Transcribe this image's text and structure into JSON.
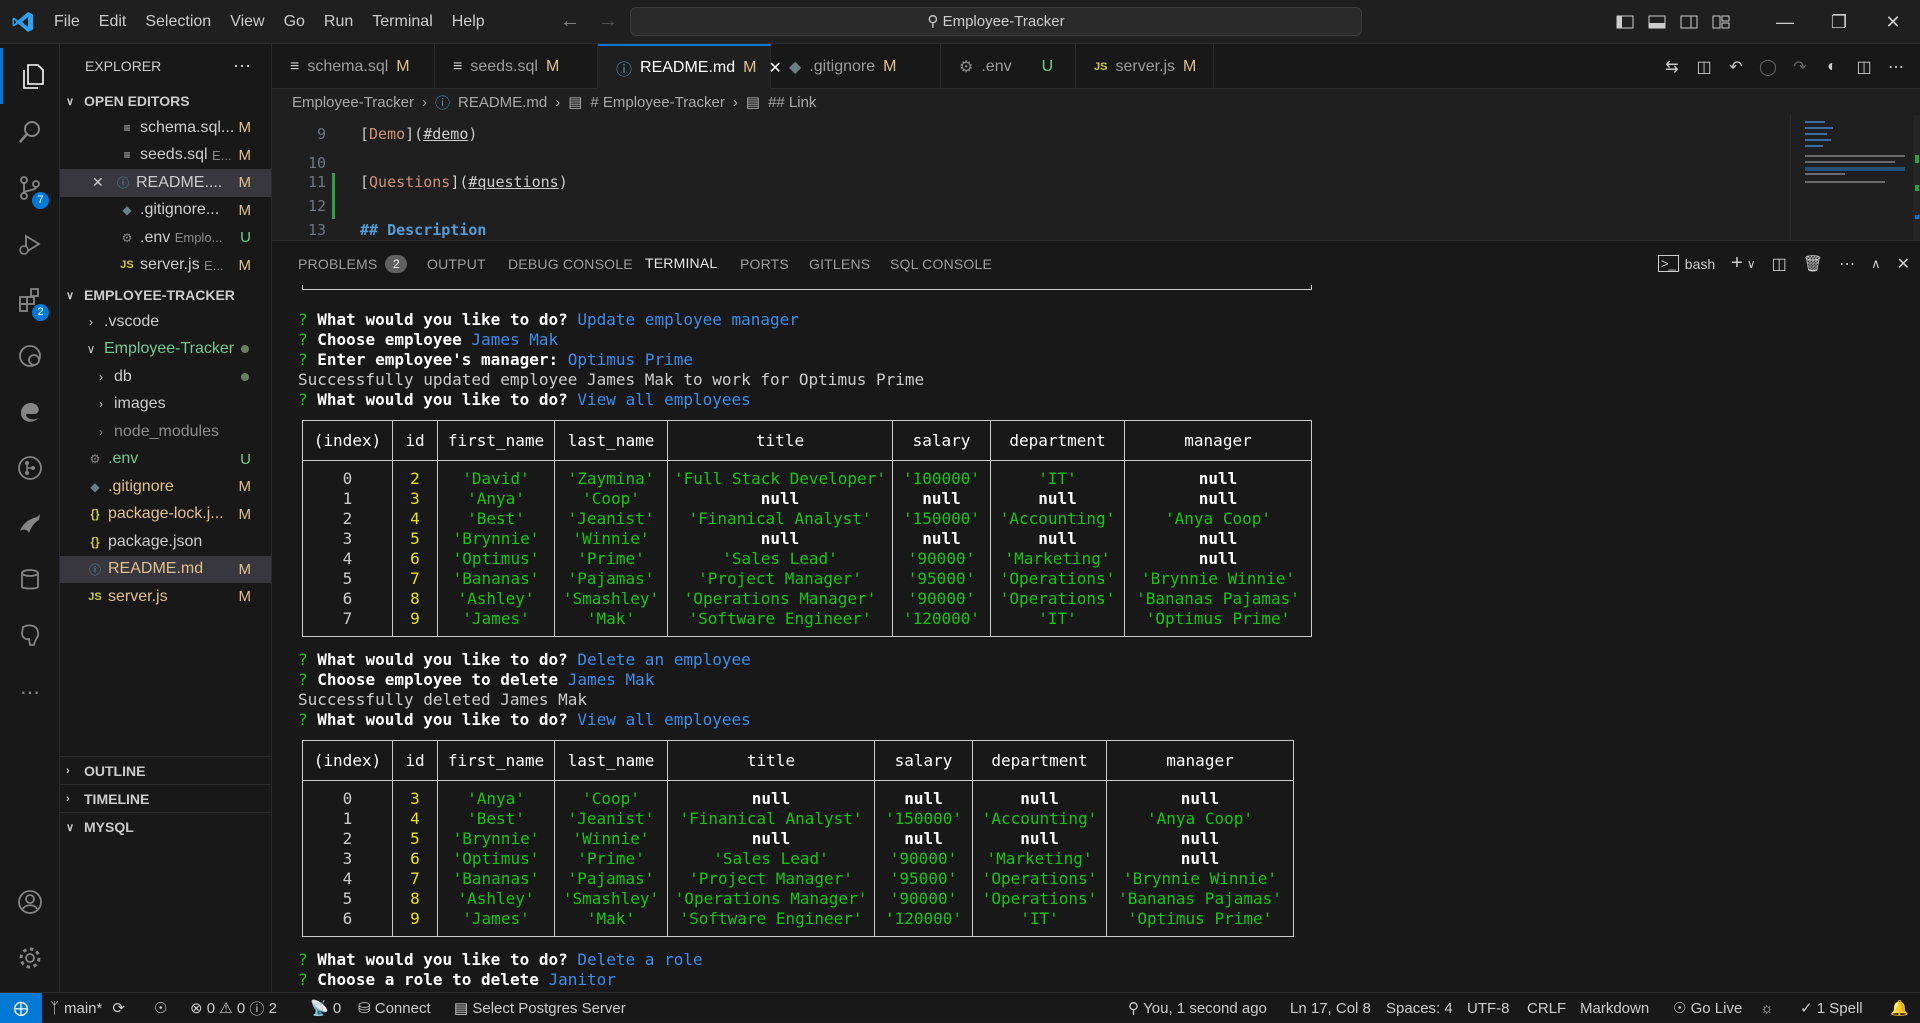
{
  "window": {
    "search_text": "Employee-Tracker"
  },
  "menu": [
    "File",
    "Edit",
    "Selection",
    "View",
    "Go",
    "Run",
    "Terminal",
    "Help"
  ],
  "activity": {
    "scm_badge": "7",
    "extensions_badge": "2"
  },
  "explorer": {
    "title": "EXPLORER",
    "open_editors_title": "OPEN EDITORS",
    "open_editors": [
      {
        "name": "schema.sql...",
        "status": "M"
      },
      {
        "name": "seeds.sql",
        "hint": "E...",
        "status": "M"
      },
      {
        "name": "README....",
        "status": "M"
      },
      {
        "name": ".gitignore...",
        "status": "M"
      },
      {
        "name": ".env",
        "hint": "Emplo...",
        "status": "U"
      },
      {
        "name": "server.js",
        "hint": "E...",
        "status": "M"
      }
    ],
    "project_title": "EMPLOYEE-TRACKER",
    "tree": [
      {
        "name": ".vscode"
      },
      {
        "name": "Employee-Tracker"
      },
      {
        "name": "db"
      },
      {
        "name": "images"
      },
      {
        "name": "node_modules"
      },
      {
        "name": ".env",
        "status": "U"
      },
      {
        "name": ".gitignore",
        "status": "M"
      },
      {
        "name": "package-lock.j...",
        "status": "M"
      },
      {
        "name": "package.json"
      },
      {
        "name": "README.md",
        "status": "M"
      },
      {
        "name": "server.js",
        "status": "M"
      }
    ],
    "outline": "OUTLINE",
    "timeline": "TIMELINE",
    "mysql": "MYSQL"
  },
  "tabs": [
    {
      "label": "schema.sql",
      "status": "M"
    },
    {
      "label": "seeds.sql",
      "status": "M"
    },
    {
      "label": "README.md",
      "status": "M"
    },
    {
      "label": ".gitignore",
      "status": "M"
    },
    {
      "label": ".env",
      "status": "U"
    },
    {
      "label": "server.js",
      "status": "M"
    }
  ],
  "breadcrumb": [
    "Employee-Tracker",
    "README.md",
    "# Employee-Tracker",
    "## Link"
  ],
  "editor": {
    "line_numbers": [
      "9",
      "10",
      "11",
      "12",
      "13"
    ],
    "l9": {
      "text": "Demo",
      "link": "#demo"
    },
    "l11": {
      "text": "Questions",
      "link": "#questions"
    },
    "l13": "## Description"
  },
  "panel": {
    "tabs": [
      "PROBLEMS",
      "OUTPUT",
      "DEBUG CONSOLE",
      "TERMINAL",
      "PORTS",
      "GITLENS",
      "SQL CONSOLE"
    ],
    "problems_count": "2",
    "shell": "bash"
  },
  "terminal": {
    "lines1": [
      {
        "prompt": "?",
        "q": "What would you like to do?",
        "a": "Update employee manager"
      },
      {
        "prompt": "?",
        "q": "Choose employee",
        "a": "James Mak"
      },
      {
        "prompt": "?",
        "q": "Enter employee's manager:",
        "a": "Optimus Prime"
      },
      {
        "plain": "Successfully updated employee James Mak to work for Optimus Prime"
      },
      {
        "prompt": "?",
        "q": "What would you like to do?",
        "a": "View all employees"
      }
    ],
    "headers": [
      "(index)",
      "id",
      "first_name",
      "last_name",
      "title",
      "salary",
      "department",
      "manager"
    ],
    "table1": [
      [
        "0",
        "2",
        "'David'",
        "'Zaymina'",
        "'Full Stack Developer'",
        "'100000'",
        "'IT'",
        "null"
      ],
      [
        "1",
        "3",
        "'Anya'",
        "'Coop'",
        "null",
        "null",
        "null",
        "null"
      ],
      [
        "2",
        "4",
        "'Best'",
        "'Jeanist'",
        "'Finanical Analyst'",
        "'150000'",
        "'Accounting'",
        "'Anya Coop'"
      ],
      [
        "3",
        "5",
        "'Brynnie'",
        "'Winnie'",
        "null",
        "null",
        "null",
        "null"
      ],
      [
        "4",
        "6",
        "'Optimus'",
        "'Prime'",
        "'Sales Lead'",
        "'90000'",
        "'Marketing'",
        "null"
      ],
      [
        "5",
        "7",
        "'Bananas'",
        "'Pajamas'",
        "'Project Manager'",
        "'95000'",
        "'Operations'",
        "'Brynnie Winnie'"
      ],
      [
        "6",
        "8",
        "'Ashley'",
        "'Smashley'",
        "'Operations Manager'",
        "'90000'",
        "'Operations'",
        "'Bananas Pajamas'"
      ],
      [
        "7",
        "9",
        "'James'",
        "'Mak'",
        "'Software Engineer'",
        "'120000'",
        "'IT'",
        "'Optimus Prime'"
      ]
    ],
    "lines2": [
      {
        "prompt": "?",
        "q": "What would you like to do?",
        "a": "Delete an employee"
      },
      {
        "prompt": "?",
        "q": "Choose employee to delete",
        "a": "James Mak"
      },
      {
        "plain": "Successfully deleted James Mak"
      },
      {
        "prompt": "?",
        "q": "What would you like to do?",
        "a": "View all employees"
      }
    ],
    "table2": [
      [
        "0",
        "3",
        "'Anya'",
        "'Coop'",
        "null",
        "null",
        "null",
        "null"
      ],
      [
        "1",
        "4",
        "'Best'",
        "'Jeanist'",
        "'Finanical Analyst'",
        "'150000'",
        "'Accounting'",
        "'Anya Coop'"
      ],
      [
        "2",
        "5",
        "'Brynnie'",
        "'Winnie'",
        "null",
        "null",
        "null",
        "null"
      ],
      [
        "3",
        "6",
        "'Optimus'",
        "'Prime'",
        "'Sales Lead'",
        "'90000'",
        "'Marketing'",
        "null"
      ],
      [
        "4",
        "7",
        "'Bananas'",
        "'Pajamas'",
        "'Project Manager'",
        "'95000'",
        "'Operations'",
        "'Brynnie Winnie'"
      ],
      [
        "5",
        "8",
        "'Ashley'",
        "'Smashley'",
        "'Operations Manager'",
        "'90000'",
        "'Operations'",
        "'Bananas Pajamas'"
      ],
      [
        "6",
        "9",
        "'James'",
        "'Mak'",
        "'Software Engineer'",
        "'120000'",
        "'IT'",
        "'Optimus Prime'"
      ]
    ],
    "lines3": [
      {
        "prompt": "?",
        "q": "What would you like to do?",
        "a": "Delete a role"
      },
      {
        "prompt": "?",
        "q": "Choose a role to delete",
        "a": "Janitor"
      }
    ]
  },
  "status": {
    "branch": "main*",
    "errors": "0",
    "warnings": "0",
    "infos": "2",
    "ports": "0",
    "connect": "Connect",
    "postgres": "Select Postgres Server",
    "blame": "You, 1 second ago",
    "position": "Ln 17, Col 8",
    "spaces": "Spaces: 4",
    "encoding": "UTF-8",
    "eol": "CRLF",
    "language": "Markdown",
    "golive": "Go Live",
    "spell": "1 Spell"
  },
  "colors": {
    "accent": "#0078d4",
    "modified": "#e2c08d",
    "untracked": "#73c991",
    "term_green": "#16c60c",
    "term_yellow": "#e5e510",
    "term_blue": "#3b8eea"
  }
}
